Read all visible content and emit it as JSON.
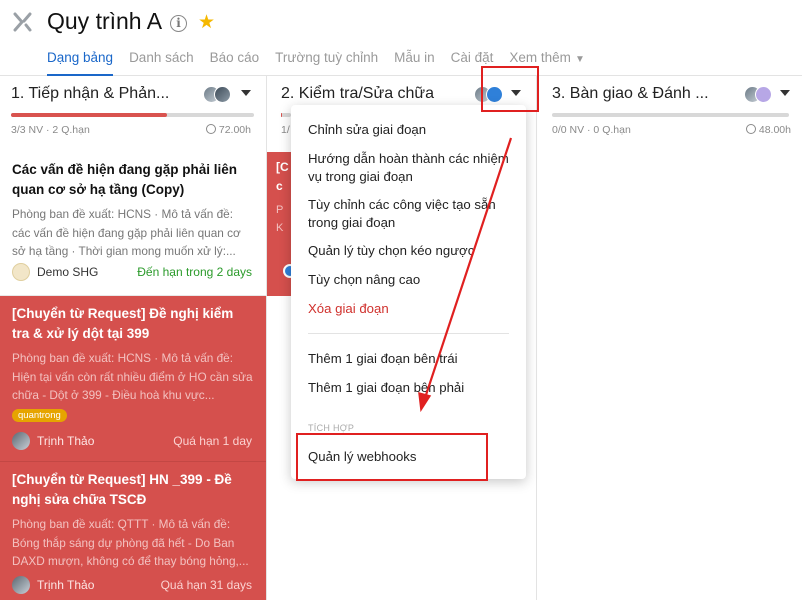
{
  "header": {
    "title": "Quy trình A",
    "info_icon": "info-icon",
    "star_icon": "star-icon",
    "logo_icon": "logo-icon"
  },
  "tabs": [
    {
      "label": "Dạng bảng",
      "active": true
    },
    {
      "label": "Danh sách"
    },
    {
      "label": "Báo cáo"
    },
    {
      "label": "Trường tuỳ chỉnh"
    },
    {
      "label": "Mẫu in"
    },
    {
      "label": "Cài đặt"
    },
    {
      "label": "Xem thêm",
      "icon": "chevron-down-icon"
    }
  ],
  "columns": [
    {
      "title": "1. Tiếp nhận & Phản...",
      "stats": "3/3 NV · 2 Q.hạn",
      "hours": "72.00h",
      "progress": 0.64
    },
    {
      "title": "2. Kiểm tra/Sửa chữa",
      "stats": "1/",
      "hours": "",
      "progress": 0.05
    },
    {
      "title": "3. Bàn giao & Đánh ...",
      "stats": "0/0 NV · 0 Q.hạn",
      "hours": "48.00h",
      "progress": 0
    }
  ],
  "cards": [
    {
      "title": "Các vấn đề hiện đang gặp phải liên quan cơ sở hạ tầng (Copy)",
      "desc": "Phòng ban đề xuất: HCNS · Mô tả vấn đề: các vấn đề hiện đang gặp phải liên quan cơ sở hạ tầng · Thời gian mong muốn xử lý:...",
      "assignee": "Demo SHG",
      "due": "Đến hạn trong 2 days",
      "tag": "",
      "overdue": false
    },
    {
      "title": "[Chuyển từ Request] Đề nghị kiểm tra & xử lý dột tại 399",
      "desc": "Phòng ban đề xuất: HCNS · Mô tả vấn đề: Hiện tại vấn còn rất nhiều điểm ở HO cần sửa chữa - Dột ở 399 - Điều hoà khu vực...",
      "assignee": "Trịnh Thảo",
      "due": "Quá hạn 1 day",
      "tag": "quantrong",
      "overdue": true
    },
    {
      "title": "[Chuyển từ Request] HN _399 - Đề nghị sửa chữa TSCĐ",
      "desc": "Phòng ban đề xuất: QTTT · Mô tả vấn đề: Bóng thắp sáng dự phòng đã hết - Do Ban DAXD mượn, không có để thay bóng hỏng,...",
      "assignee": "Trịnh Thảo",
      "due": "Quá hạn 31 days",
      "tag": "",
      "overdue": true
    }
  ],
  "column2_partial_card": {
    "letters": [
      "[C",
      "c"
    ],
    "faint": [
      "P",
      "K"
    ]
  },
  "stage_menu": {
    "items": [
      {
        "label": "Chỉnh sửa giai đoạn"
      },
      {
        "label": "Hướng dẫn hoàn thành các nhiệm vụ trong giai đoạn"
      },
      {
        "label": "Tùy chỉnh các công việc tạo sẵn trong giai đoạn"
      },
      {
        "label": "Quản lý tùy chọn kéo ngược"
      },
      {
        "label": "Tùy chọn nâng cao"
      },
      {
        "label": "Xóa giai đoạn",
        "danger": true
      }
    ],
    "add_items": [
      {
        "label": "Thêm 1 giai đoạn bên trái"
      },
      {
        "label": "Thêm 1 giai đoạn bên phải"
      }
    ],
    "section_label": "TÍCH HỢP",
    "integration_items": [
      {
        "label": "Quản lý webhooks"
      }
    ]
  },
  "annotation_color": "#e02020",
  "accent_color": "#1a67c9",
  "overdue_color": "#d5504d"
}
